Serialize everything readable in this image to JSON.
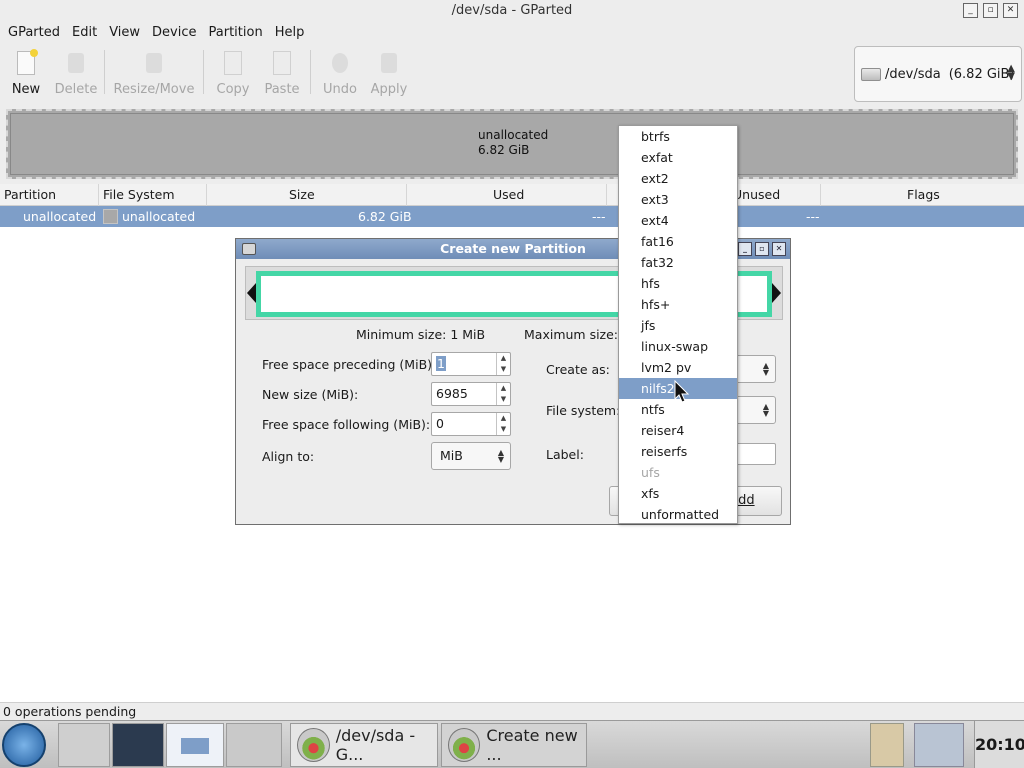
{
  "window": {
    "title": "/dev/sda - GParted"
  },
  "menu": [
    "GParted",
    "Edit",
    "View",
    "Device",
    "Partition",
    "Help"
  ],
  "toolbar": {
    "new": "New",
    "delete": "Delete",
    "resize_move": "Resize/Move",
    "copy": "Copy",
    "paste": "Paste",
    "undo": "Undo",
    "apply": "Apply"
  },
  "device_selector": {
    "device": "/dev/sda",
    "size": "(6.82 GiB)"
  },
  "graphic": {
    "label": "unallocated",
    "size": "6.82 GiB"
  },
  "partition_list": {
    "headers": [
      "Partition",
      "File System",
      "Size",
      "Used",
      "Unused",
      "Flags"
    ],
    "row": {
      "partition": "unallocated",
      "filesystem": "unallocated",
      "size": "6.82 GiB",
      "used": "---",
      "unused": "---",
      "flags": ""
    }
  },
  "status": {
    "text": "0 operations pending"
  },
  "dialog": {
    "title": "Create new Partition",
    "min_size": "Minimum size: 1 MiB",
    "max_size": "Maximum size: 6",
    "free_preceding_label": "Free space preceding (MiB):",
    "free_preceding_value": "1",
    "new_size_label": "New size (MiB):",
    "new_size_value": "6985",
    "free_following_label": "Free space following (MiB):",
    "free_following_value": "0",
    "align_label": "Align to:",
    "align_value": "MiB",
    "create_as_label": "Create as:",
    "filesystem_label": "File system:",
    "label_label": "Label:",
    "add_button": "Add"
  },
  "filesystem_dropdown": {
    "items": [
      "btrfs",
      "exfat",
      "ext2",
      "ext3",
      "ext4",
      "fat16",
      "fat32",
      "hfs",
      "hfs+",
      "jfs",
      "linux-swap",
      "lvm2 pv",
      "nilfs2",
      "ntfs",
      "reiser4",
      "reiserfs",
      "ufs",
      "xfs",
      "unformatted"
    ],
    "selected": "nilfs2",
    "disabled": [
      "ufs"
    ]
  },
  "taskbar": {
    "tasks": [
      "/dev/sda - G...",
      "Create new ..."
    ],
    "clock": "20:10"
  },
  "colors": {
    "selection": "#7e9ec8",
    "accent_green": "#44d6a6",
    "unallocated": "#a8a8a8"
  }
}
